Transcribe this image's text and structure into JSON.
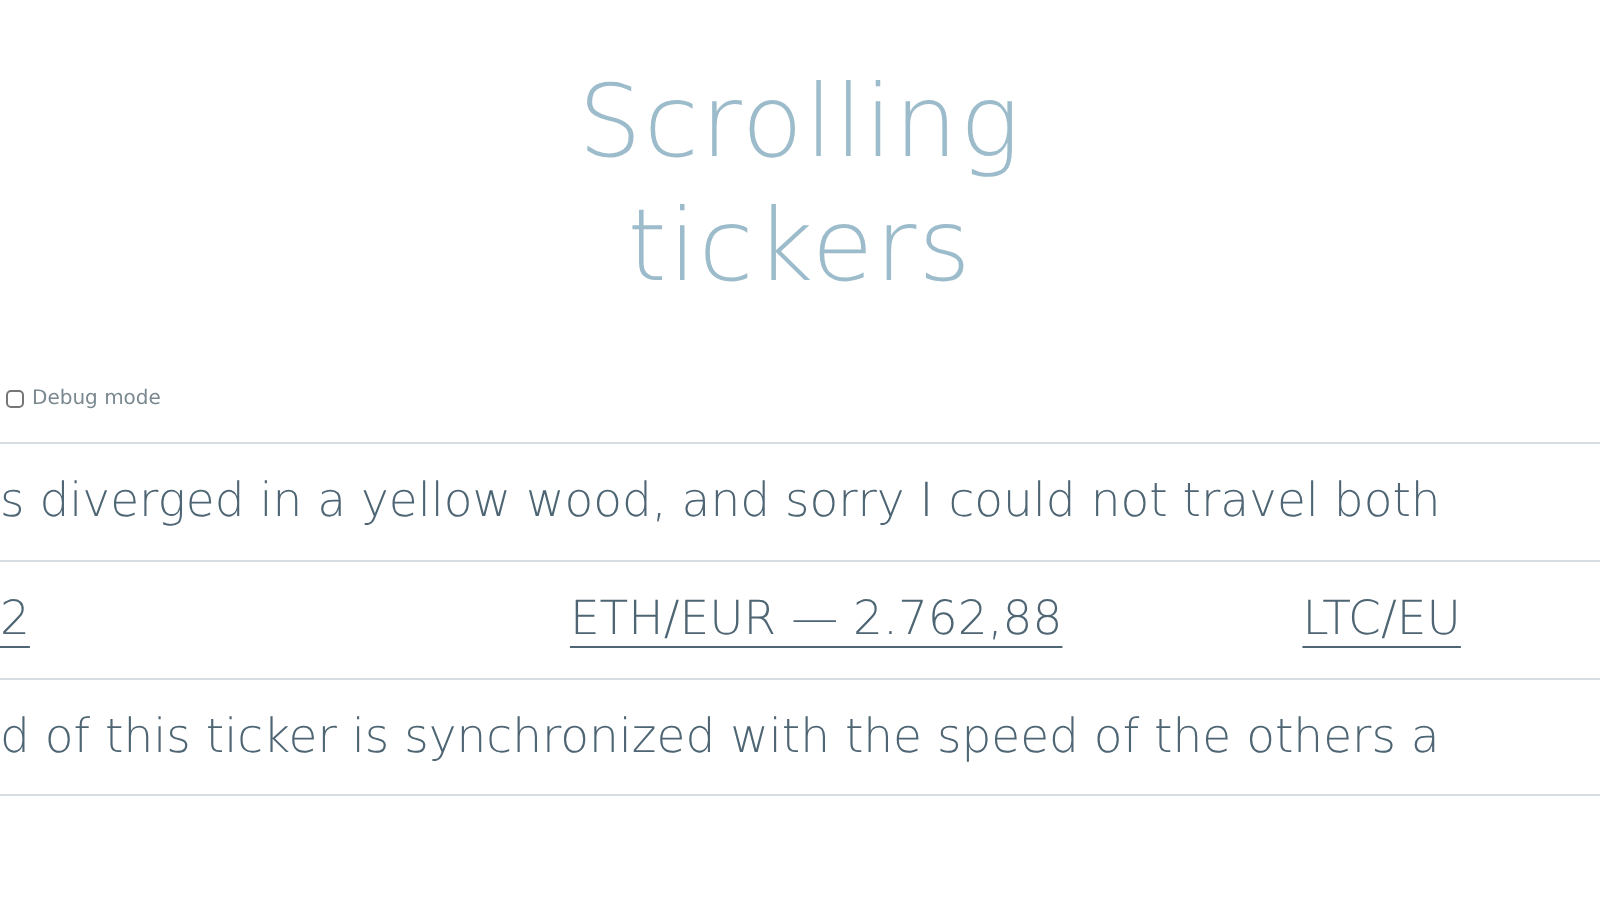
{
  "title": "Scrolling tickers",
  "debug": {
    "label": "Debug mode",
    "checked": false
  },
  "tickers": [
    {
      "kind": "text",
      "items": [
        "s diverged in a yellow wood, and sorry I could not travel both"
      ]
    },
    {
      "kind": "links",
      "items": [
        "2",
        "ETH/EUR — 2.762,88",
        "LTC/EU"
      ]
    },
    {
      "kind": "text",
      "items": [
        "d of this ticker is synchronized with the speed of the others a"
      ]
    }
  ]
}
